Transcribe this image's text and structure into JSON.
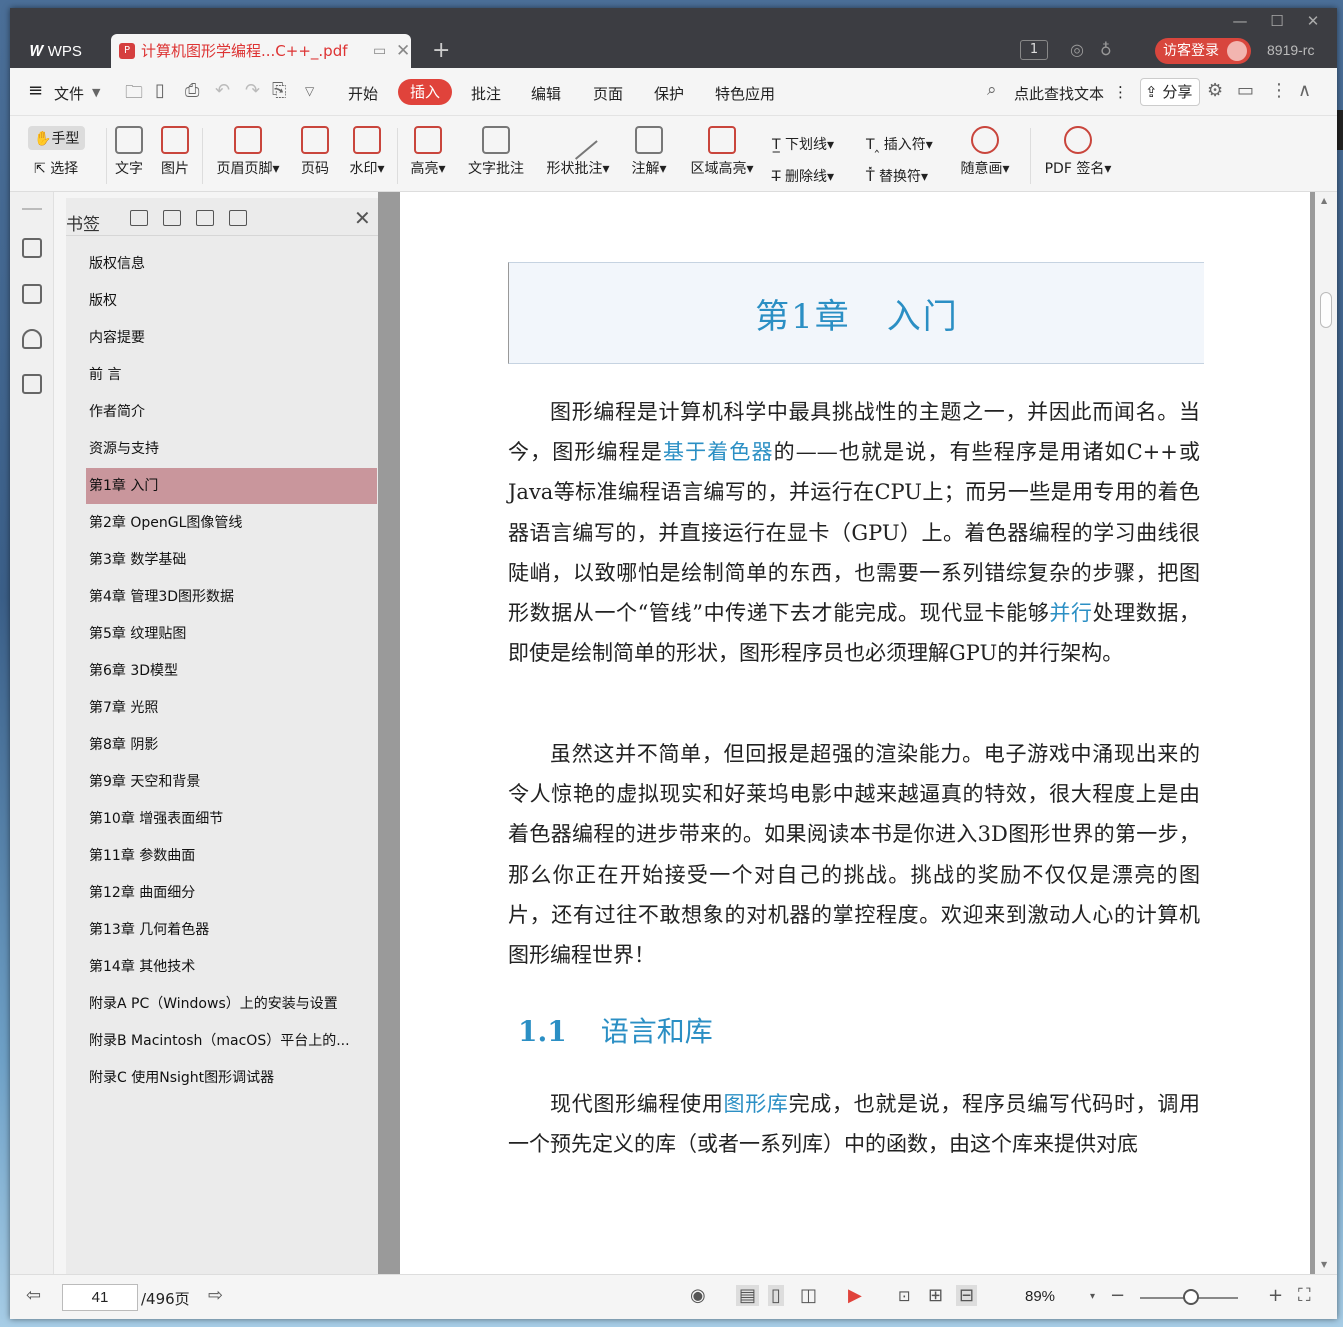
{
  "app": {
    "brand": "WPS",
    "tab_title": "计算机图形学编程...C++_.pdf",
    "page_badge": "1",
    "login": "访客登录",
    "user_id": "8919-rc"
  },
  "menu": {
    "file": "文件",
    "items": [
      "开始",
      "插入",
      "批注",
      "编辑",
      "页面",
      "保护",
      "特色应用"
    ],
    "search": "点此查找文本",
    "share": "分享"
  },
  "ribbon": {
    "hand": "手型",
    "select": "选择",
    "text": "文字",
    "image": "图片",
    "header_footer": "页眉页脚",
    "page_number": "页码",
    "watermark": "水印",
    "highlight": "高亮",
    "text_note": "文字批注",
    "shape_note": "形状批注",
    "annotation": "注解",
    "area_highlight": "区域高亮",
    "underline": "下划线",
    "strike": "删除线",
    "insert_char": "插入符",
    "replace_char": "替换符",
    "freehand": "随意画",
    "pdf_sign": "PDF 签名"
  },
  "bookmarks": {
    "title": "书签",
    "items": [
      "版权信息",
      "版权",
      "内容提要",
      "前 言",
      "作者简介",
      "资源与支持",
      "第1章 入门",
      "第2章 OpenGL图像管线",
      "第3章 数学基础",
      "第4章 管理3D图形数据",
      "第5章 纹理贴图",
      "第6章 3D模型",
      "第7章 光照",
      "第8章 阴影",
      "第9章 天空和背景",
      "第10章 增强表面细节",
      "第11章 参数曲面",
      "第12章 曲面细分",
      "第13章 几何着色器",
      "第14章 其他技术",
      "附录A PC（Windows）上的安装与设置",
      "附录B Macintosh（macOS）平台上的...",
      "附录C 使用Nsight图形调试器"
    ]
  },
  "document": {
    "chapter_title": "第1章　入门",
    "p1_a": "图形编程是计算机科学中最具挑战性的主题之一，并因此而闻名。当今，图形编程是",
    "p1_link1": "基于着色器",
    "p1_b": "的——也就是说，有些程序是用诸如C++或Java等标准编程语言编写的，并运行在CPU上；而另一些是用专用的着色器语言编写的，并直接运行在显卡（GPU）上。着色器编程的学习曲线很陡峭，以致哪怕是绘制简单的东西，也需要一系列错综复杂的步骤，把图形数据从一个“管线”中传递下去才能完成。现代显卡能够",
    "p1_link2": "并行",
    "p1_c": "处理数据，即使是绘制简单的形状，图形程序员也必须理解GPU的并行架构。",
    "p2": "虽然这并不简单，但回报是超强的渲染能力。电子游戏中涌现出来的令人惊艳的虚拟现实和好莱坞电影中越来越逼真的特效，很大程度上是由着色器编程的进步带来的。如果阅读本书是你进入3D图形世界的第一步，那么你正在开始接受一个对自己的挑战。挑战的奖励不仅仅是漂亮的图片，还有过往不敢想象的对机器的掌控程度。欢迎来到激动人心的计算机图形编程世界！",
    "section_num": "1.1",
    "section_title": "语言和库",
    "p3_a": "现代图形编程使用",
    "p3_link": "图形库",
    "p3_b": "完成，也就是说，程序员编写代码时，调用一个预先定义的库（或者一系列库）中的函数，由这个库来提供对底"
  },
  "status": {
    "page": "41",
    "total": "/496页",
    "zoom": "89%"
  }
}
